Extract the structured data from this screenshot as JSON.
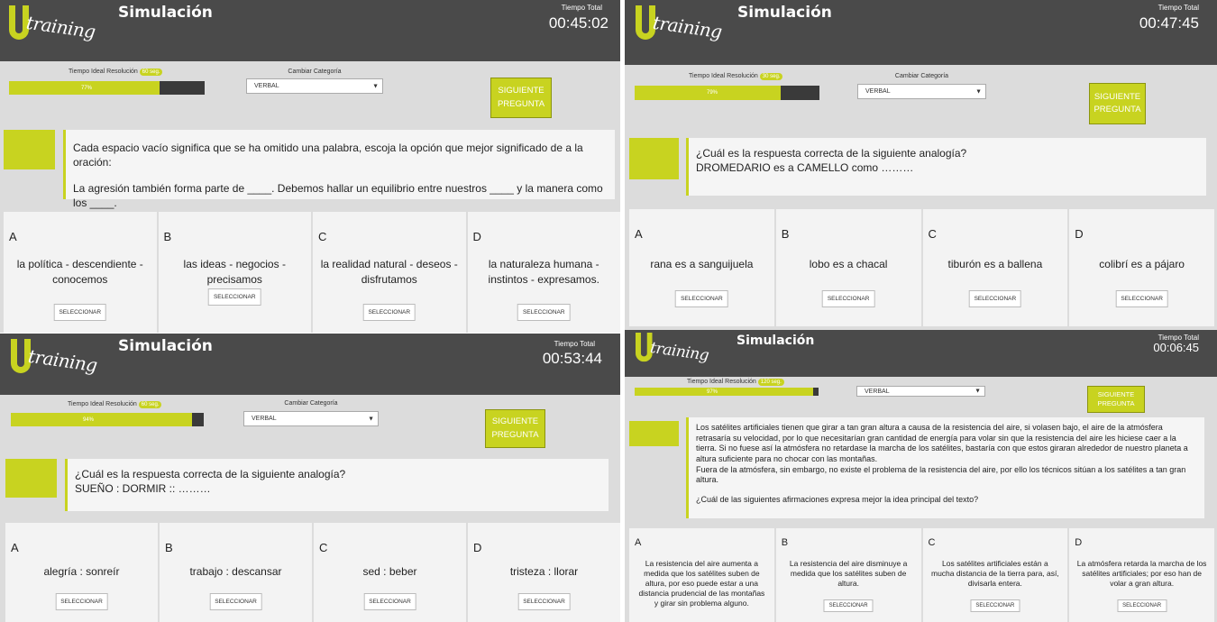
{
  "colors": {
    "accent": "#c8d320",
    "header": "#4a4a4a",
    "panel_bg": "#dcdcdc",
    "card_bg": "#f3f3f3"
  },
  "icons": {
    "logo": "u-training-logo",
    "dropdown": "caret-down-icon"
  },
  "common": {
    "app_title": "Simulación",
    "logo_text": "training",
    "tiempo_total_label": "Tiempo Total",
    "tiempo_ideal_label": "Tiempo Ideal Resolución",
    "category_label": "Cambiar Categoría",
    "category_value": "VERBAL",
    "next_button": "SIGUIENTE PREGUNTA",
    "select_button": "SELECCIONAR"
  },
  "panels": [
    {
      "timer": "00:45:02",
      "ideal_seconds": "60 seg.",
      "progress": 0.77,
      "progress_label": "77%",
      "question_lines": [
        "Cada espacio vacío significa que se ha omitido una palabra, escoja la opción que mejor significado de a la oración:",
        "La agresión también forma parte de ____. Debemos hallar un equilibrio entre nuestros ____ y la manera como los ____."
      ],
      "options": [
        {
          "letter": "A",
          "text": "la política - descendiente - conocemos"
        },
        {
          "letter": "B",
          "text": "las ideas - negocios - precisamos"
        },
        {
          "letter": "C",
          "text": "la realidad natural - deseos - disfrutamos"
        },
        {
          "letter": "D",
          "text": "la naturaleza humana - instintos - expresamos."
        }
      ]
    },
    {
      "timer": "00:47:45",
      "ideal_seconds": "30 seg.",
      "progress": 0.79,
      "progress_label": "79%",
      "question_lines": [
        "¿Cuál es la respuesta correcta de la siguiente analogía?",
        "DROMEDARIO es a CAMELLO como ………"
      ],
      "options": [
        {
          "letter": "A",
          "text": "rana es a sanguijuela"
        },
        {
          "letter": "B",
          "text": "lobo es a chacal"
        },
        {
          "letter": "C",
          "text": "tiburón es a ballena"
        },
        {
          "letter": "D",
          "text": "colibrí es a pájaro"
        }
      ]
    },
    {
      "timer": "00:53:44",
      "ideal_seconds": "60 seg.",
      "progress": 0.94,
      "progress_label": "94%",
      "question_lines": [
        "¿Cuál es la respuesta correcta de la siguiente analogía?",
        "SUEÑO : DORMIR :: ………"
      ],
      "options": [
        {
          "letter": "A",
          "text": "alegría : sonreír"
        },
        {
          "letter": "B",
          "text": "trabajo : descansar"
        },
        {
          "letter": "C",
          "text": "sed : beber"
        },
        {
          "letter": "D",
          "text": "tristeza : llorar"
        }
      ]
    },
    {
      "timer": "00:06:45",
      "ideal_seconds": "120 seg.",
      "progress": 0.97,
      "progress_label": "97%",
      "question_lines": [
        "Los satélites artificiales tienen que girar a tan gran altura a causa de la resistencia del aire, si volasen bajo, el aire de la atmósfera retrasaría su velocidad, por lo que necesitarían gran cantidad de energía para volar sin que la resistencia del aire les hiciese caer a la tierra. Si no fuese así la atmósfera no retardase la marcha de los satélites, bastaría con que estos giraran alrededor de nuestro planeta a altura suficiente para no chocar con las montañas.",
        "Fuera de la atmósfera, sin embargo, no existe el problema de la resistencia del aire, por ello los técnicos sitúan a los satélites a tan gran altura.",
        "¿Cuál de las siguientes afirmaciones expresa mejor la idea principal del texto?"
      ],
      "options": [
        {
          "letter": "A",
          "text": "La resistencia del aire aumenta a medida que los satélites suben de altura, por eso puede estar a una distancia prudencial de las montañas y girar sin problema alguno."
        },
        {
          "letter": "B",
          "text": "La resistencia del aire disminuye a medida que los satélites suben de altura."
        },
        {
          "letter": "C",
          "text": "Los satélites artificiales están a mucha distancia de la tierra para, así, divisarla entera."
        },
        {
          "letter": "D",
          "text": "La atmósfera retarda la marcha de los satélites artificiales; por eso han de volar a gran altura."
        }
      ]
    }
  ]
}
